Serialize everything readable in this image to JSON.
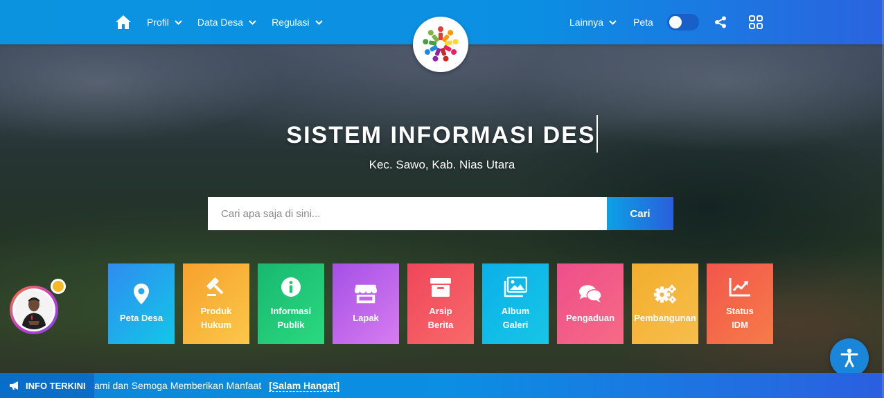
{
  "nav": {
    "left": [
      {
        "label": "Profil",
        "has_dropdown": true
      },
      {
        "label": "Data Desa",
        "has_dropdown": true
      },
      {
        "label": "Regulasi",
        "has_dropdown": true
      }
    ],
    "right": {
      "lainnya": "Lainnya",
      "peta": "Peta"
    },
    "icons": {
      "home": "home-icon",
      "share": "share-icon",
      "apps": "grid-icon"
    },
    "toggle_on": false
  },
  "hero": {
    "title": "SISTEM INFORMASI DES",
    "subtitle": "Kec. Sawo, Kab. Nias Utara"
  },
  "search": {
    "placeholder": "Cari apa saja di sini...",
    "value": "",
    "button_label": "Cari"
  },
  "tiles": [
    {
      "label": "Peta Desa",
      "icon": "map-marker-icon",
      "color_from": "#2f8cf0",
      "color_to": "#12c7e8"
    },
    {
      "label": "Produk\nHukum",
      "icon": "gavel-icon",
      "color_from": "#f7a12d",
      "color_to": "#fbc74a"
    },
    {
      "label": "Informasi\nPublik",
      "icon": "info-icon",
      "color_from": "#18b870",
      "color_to": "#2bd97f"
    },
    {
      "label": "Lapak",
      "icon": "store-icon",
      "color_from": "#a550e6",
      "color_to": "#d77cf0"
    },
    {
      "label": "Arsip\nBerita",
      "icon": "archive-icon",
      "color_from": "#f0465a",
      "color_to": "#f76a6a"
    },
    {
      "label": "Album\nGaleri",
      "icon": "images-icon",
      "color_from": "#0bb0e8",
      "color_to": "#17c6e6"
    },
    {
      "label": "Pengaduan",
      "icon": "comments-icon",
      "color_from": "#ee4f8a",
      "color_to": "#f66a86"
    },
    {
      "label": "Pembangunan",
      "icon": "cogs-icon",
      "color_from": "#f2ae2d",
      "color_to": "#f7be4c"
    },
    {
      "label": "Status\nIDM",
      "icon": "chart-line-icon",
      "color_from": "#f2564b",
      "color_to": "#f77b4a"
    }
  ],
  "ticker": {
    "label": "INFO TERKINI",
    "text": "ami dan Semoga Memberikan Manfaat",
    "link": "[Salam Hangat]"
  }
}
